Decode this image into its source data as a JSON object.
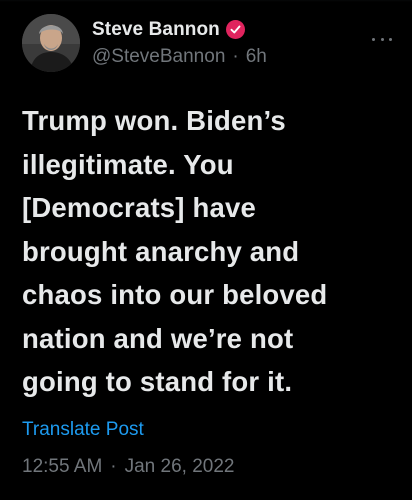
{
  "author": {
    "display_name": "Steve Bannon",
    "handle": "@SteveBannon",
    "time_ago": "6h",
    "verified_badge_icon": "checkmark-badge-icon",
    "badge_color": "#e0245e"
  },
  "tweet": {
    "text": "Trump won. Biden’s\nillegitimate. You\n[Democrats] have\nbrought anarchy and\nchaos into our beloved\nnation and we’re not\ngoing to stand for it.",
    "translate_label": "Translate Post",
    "time": "12:55 AM",
    "date": "Jan 26, 2022"
  },
  "separators": {
    "dot": "·"
  },
  "colors": {
    "background": "#000000",
    "primary_text": "#e7e9ea",
    "secondary_text": "#71767b",
    "link": "#1d9bf0"
  },
  "icons": {
    "more": "more-horizontal-icon"
  }
}
